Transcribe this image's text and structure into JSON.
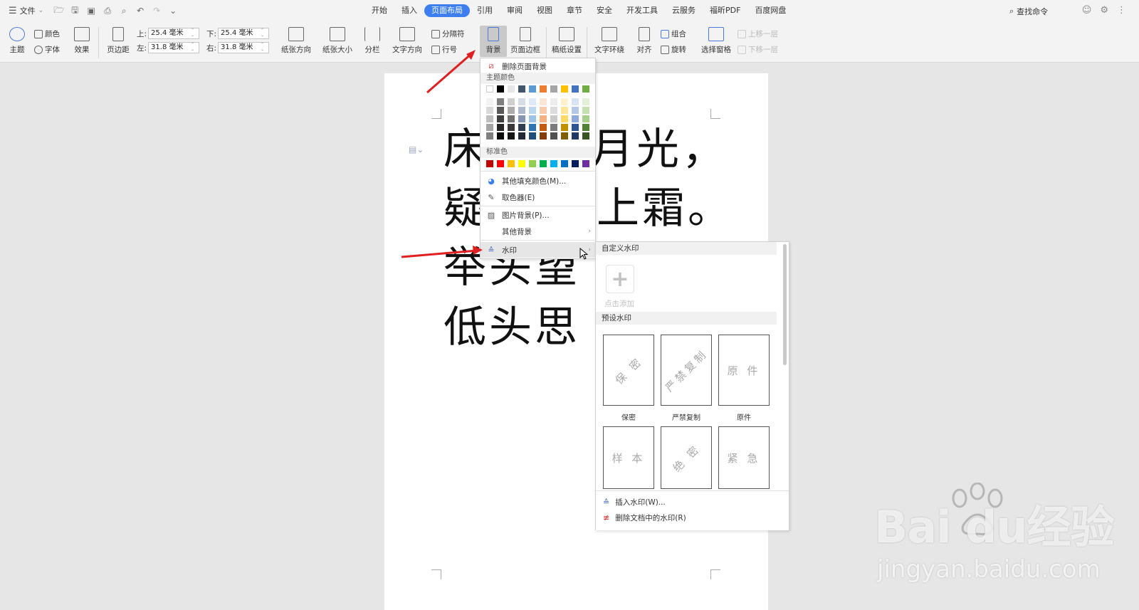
{
  "topbar": {
    "file_label": "文件",
    "tabs": [
      {
        "label": "开始",
        "active": false
      },
      {
        "label": "插入",
        "active": false
      },
      {
        "label": "页面布局",
        "active": true
      },
      {
        "label": "引用",
        "active": false
      },
      {
        "label": "审阅",
        "active": false
      },
      {
        "label": "视图",
        "active": false
      },
      {
        "label": "章节",
        "active": false
      },
      {
        "label": "安全",
        "active": false
      },
      {
        "label": "开发工具",
        "active": false
      },
      {
        "label": "云服务",
        "active": false
      },
      {
        "label": "福昕PDF",
        "active": false
      },
      {
        "label": "百度网盘",
        "active": false
      }
    ],
    "search_label": "查找命令"
  },
  "ribbon": {
    "theme": "主题",
    "colors": "颜色",
    "fonts": "字体",
    "effects": "效果",
    "margins": "页边距",
    "top_label": "上:",
    "top_value": "25.4 毫米",
    "bottom_label": "下:",
    "bottom_value": "25.4 毫米",
    "left_label": "左:",
    "left_value": "31.8 毫米",
    "right_label": "右:",
    "right_value": "31.8 毫米",
    "orientation": "纸张方向",
    "size": "纸张大小",
    "columns": "分栏",
    "text_direction": "文字方向",
    "breaks": "分隔符",
    "line_numbers": "行号",
    "background": "背景",
    "page_border": "页面边框",
    "paper_settings": "稿纸设置",
    "text_wrap": "文字环绕",
    "align": "对齐",
    "group": "组合",
    "rotate": "旋转",
    "selection_pane": "选择窗格",
    "bring_forward": "上移一层",
    "send_backward": "下移一层"
  },
  "document": {
    "lines": [
      "床",
      "月光，",
      "疑",
      "上霜。",
      "举头望",
      "低头思"
    ]
  },
  "bg_menu": {
    "remove_bg": "删除页面背景",
    "theme_colors_label": "主题颜色",
    "standard_colors_label": "标准色",
    "more_fill": "其他填充颜色(M)...",
    "eyedropper": "取色器(E)",
    "picture_bg": "图片背景(P)...",
    "other_bg": "其他背景",
    "watermark": "水印",
    "theme_top_row": [
      "#ffffff",
      "#000000",
      "#e7e6e6",
      "#44546a",
      "#5b9bd5",
      "#ed7d31",
      "#a5a5a5",
      "#ffc000",
      "#4472c4",
      "#70ad47"
    ],
    "theme_shades": [
      [
        "#f2f2f2",
        "#7f7f7f",
        "#d0cece",
        "#d6dce4",
        "#deebf6",
        "#fbe5d5",
        "#ededed",
        "#fff2cc",
        "#dae3f3",
        "#e2efd9"
      ],
      [
        "#d8d8d8",
        "#595959",
        "#aeabab",
        "#adb9ca",
        "#bdd7ee",
        "#f7cbac",
        "#dbdbdb",
        "#fee599",
        "#b4c7e7",
        "#c5e0b3"
      ],
      [
        "#bfbfbf",
        "#3f3f3f",
        "#757070",
        "#8496b0",
        "#9dc3e6",
        "#f4b183",
        "#c9c9c9",
        "#ffd965",
        "#8faadc",
        "#a8d08d"
      ],
      [
        "#a5a5a5",
        "#262626",
        "#3a3838",
        "#323f4f",
        "#2e75b5",
        "#c55a11",
        "#7b7b7b",
        "#bf9000",
        "#2f5496",
        "#538135"
      ],
      [
        "#7f7f7f",
        "#0c0c0c",
        "#171616",
        "#222a35",
        "#1e4e79",
        "#833c0b",
        "#525252",
        "#7f6000",
        "#1f3864",
        "#375623"
      ]
    ],
    "standard": [
      "#c00000",
      "#ff0000",
      "#ffc000",
      "#ffff00",
      "#92d050",
      "#00b050",
      "#00b0f0",
      "#0070c0",
      "#002060",
      "#7030a0"
    ]
  },
  "watermark_menu": {
    "custom_label": "自定义水印",
    "add_label": "点击添加",
    "preset_label": "预设水印",
    "presets": [
      {
        "text": "保 密",
        "label": "保密",
        "rotated": true
      },
      {
        "text": "严禁复制",
        "label": "严禁复制",
        "rotated": true
      },
      {
        "text": "原 件",
        "label": "原件",
        "rotated": false
      },
      {
        "text": "样 本",
        "label": "",
        "rotated": false
      },
      {
        "text": "绝 密",
        "label": "",
        "rotated": true
      },
      {
        "text": "紧 急",
        "label": "",
        "rotated": false
      }
    ],
    "insert": "插入水印(W)...",
    "remove": "删除文档中的水印(R)"
  },
  "site_watermark": {
    "brand": "Bai du经验",
    "url": "jingyan.baidu.com"
  },
  "colors": {
    "accent": "#3d7ff0",
    "annotation": "#e02020"
  }
}
